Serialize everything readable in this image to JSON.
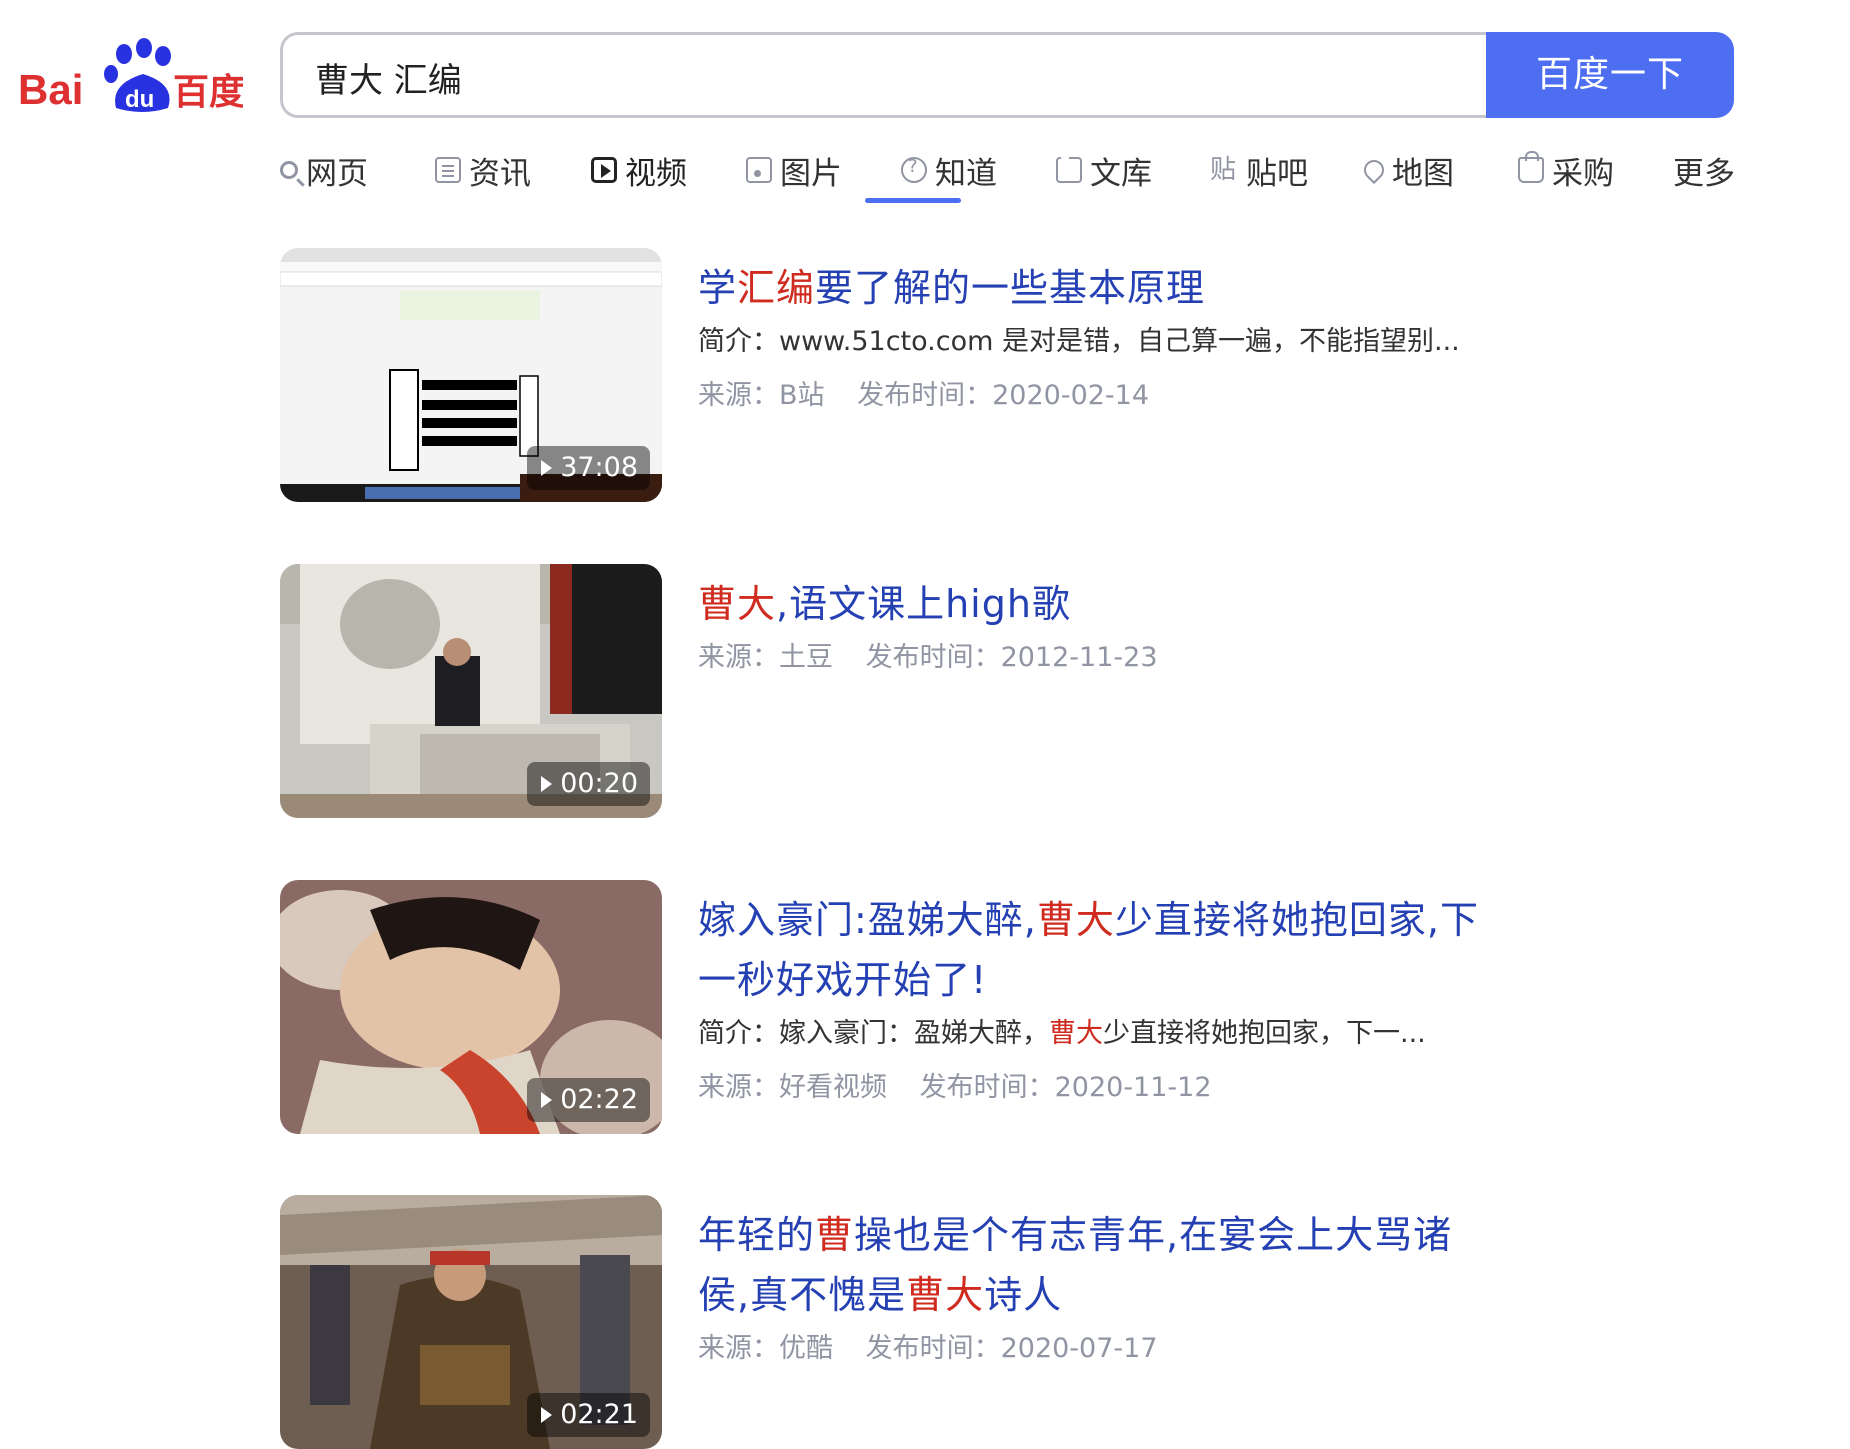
{
  "logo": {
    "text_latin": "Bai",
    "text_du": "du",
    "text_cn": "百度"
  },
  "search": {
    "query": "曹大 汇编",
    "button_label": "百度一下"
  },
  "tabs": [
    {
      "label": "网页",
      "icon": "search-icon"
    },
    {
      "label": "资讯",
      "icon": "news-icon"
    },
    {
      "label": "视频",
      "icon": "video-icon",
      "active": true
    },
    {
      "label": "图片",
      "icon": "image-icon"
    },
    {
      "label": "知道",
      "icon": "question-icon"
    },
    {
      "label": "文库",
      "icon": "document-icon"
    },
    {
      "label": "贴吧",
      "icon": "tieba-icon"
    },
    {
      "label": "地图",
      "icon": "map-pin-icon"
    },
    {
      "label": "采购",
      "icon": "shopping-bag-icon"
    },
    {
      "label": "更多"
    }
  ],
  "results": [
    {
      "title_parts": [
        {
          "t": "学"
        },
        {
          "t": "汇编",
          "hl": true
        },
        {
          "t": "要了解的一些基本原理"
        }
      ],
      "summary": "简介：www.51cto.com 是对是错，自己算一遍，不能指望别...",
      "source": "来源：B站",
      "date": "发布时间：2020-02-14",
      "duration": "37:08"
    },
    {
      "title_parts": [
        {
          "t": "曹大",
          "hl": true
        },
        {
          "t": ",语文课上high歌"
        }
      ],
      "source": "来源：土豆",
      "date": "发布时间：2012-11-23",
      "duration": "00:20"
    },
    {
      "title_line1": [
        {
          "t": "嫁入豪门:盈娣大醉,"
        },
        {
          "t": "曹大",
          "hl": true
        },
        {
          "t": "少直接将她抱回家,下"
        }
      ],
      "title_line2": [
        {
          "t": "一秒好戏开始了!"
        }
      ],
      "summary_parts": [
        {
          "t": "简介：嫁入豪门：盈娣大醉，"
        },
        {
          "t": "曹大",
          "hl": true
        },
        {
          "t": "少直接将她抱回家，下一..."
        }
      ],
      "source": "来源：好看视频",
      "date": "发布时间：2020-11-12",
      "duration": "02:22"
    },
    {
      "title_line1": [
        {
          "t": "年轻的"
        },
        {
          "t": "曹",
          "hl": true
        },
        {
          "t": "操也是个有志青年,在宴会上大骂诸"
        }
      ],
      "title_line2": [
        {
          "t": "侯,真不愧是"
        },
        {
          "t": "曹大",
          "hl": true
        },
        {
          "t": "诗人"
        }
      ],
      "source": "来源：优酷",
      "date": "发布时间：2020-07-17",
      "duration": "02:21"
    }
  ],
  "colors": {
    "accent": "#4e6ef2",
    "link": "#2440b3",
    "highlight": "#d02b1f",
    "meta": "#9195a3",
    "logo_red": "#de3031",
    "logo_blue": "#2932e1"
  }
}
